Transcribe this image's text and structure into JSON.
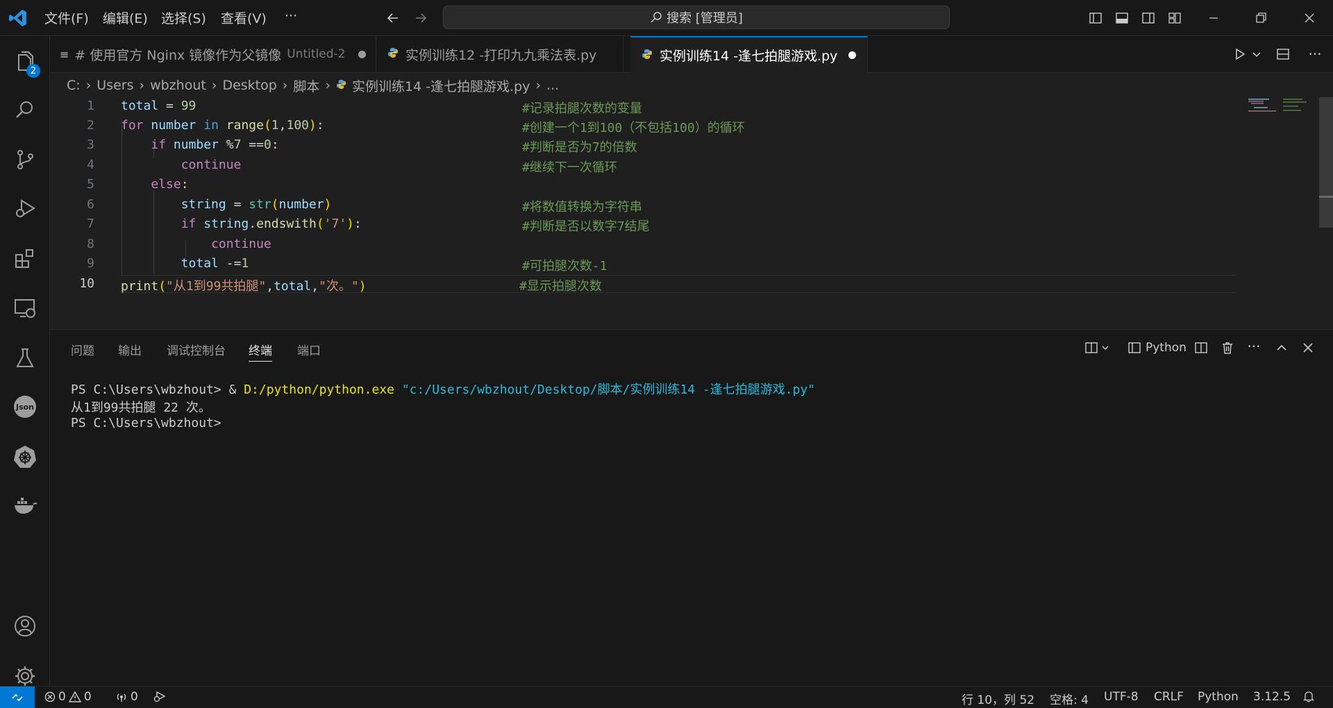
{
  "menu": {
    "file": "文件(F)",
    "edit": "编辑(E)",
    "select": "选择(S)",
    "view": "查看(V)",
    "more": "···"
  },
  "search": {
    "label": "搜索 [管理员]"
  },
  "activity": {
    "explorer_badge": "2"
  },
  "tabs": [
    {
      "label": "# 使用官方 Nginx 镜像作为父镜像",
      "sub": "Untitled-2"
    },
    {
      "label": "实例训练12 -打印九九乘法表.py"
    },
    {
      "label": "实例训练14 -逢七拍腿游戏.py"
    }
  ],
  "breadcrumb": {
    "drive": "C:",
    "users": "Users",
    "user": "wbzhout",
    "desktop": "Desktop",
    "folder": "脚本",
    "file": "实例训练14 -逢七拍腿游戏.py",
    "more": "..."
  },
  "editor": {
    "line_numbers": [
      "1",
      "2",
      "3",
      "4",
      "5",
      "6",
      "7",
      "8",
      "9",
      "10"
    ],
    "comments": [
      "#记录拍腿次数的变量",
      "#创建一个1到100（不包括100）的循环",
      "#判断是否为7的倍数",
      "#继续下一次循环",
      "#将数值转换为字符串",
      "#判断是否以数字7结尾",
      "#可拍腿次数-1",
      "#显示拍腿次数"
    ]
  },
  "panel": {
    "tabs": [
      "问题",
      "输出",
      "调试控制台",
      "终端",
      "端口"
    ],
    "python_label": "Python",
    "terminal": {
      "prompt1": "PS C:\\Users\\wbzhout> & ",
      "exe": "D:/python/python.exe",
      "path": "\"c:/Users/wbzhout/Desktop/脚本/实例训练14 -逢七拍腿游戏.py\"",
      "output": "从1到99共拍腿 22 次。",
      "prompt2": "PS C:\\Users\\wbzhout>"
    }
  },
  "status": {
    "errors": "0",
    "warnings": "0",
    "ports": "0",
    "position": "行 10，列 52",
    "spaces": "空格: 4",
    "encoding": "UTF-8",
    "eol": "CRLF",
    "language": "Python",
    "version": "3.12.5"
  },
  "colors": {
    "accent": "#0078d4",
    "remote": "#0078d4"
  }
}
